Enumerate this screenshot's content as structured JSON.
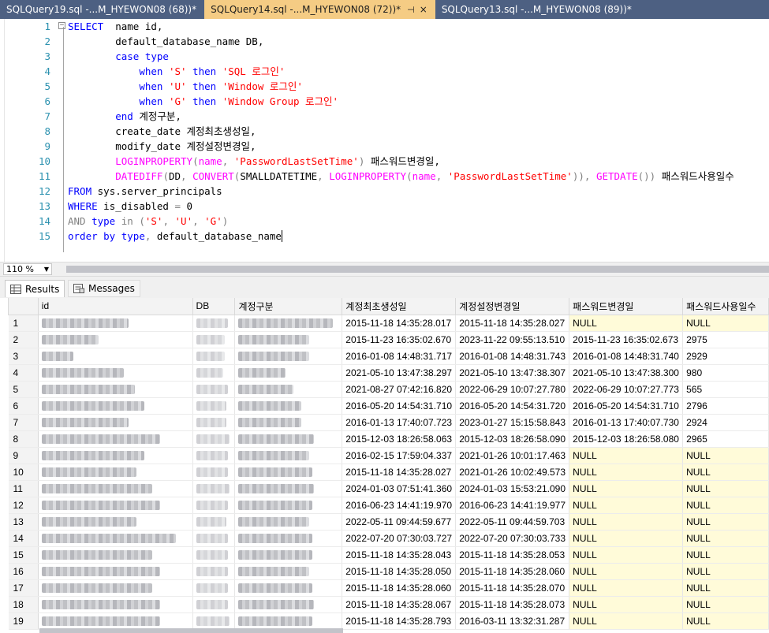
{
  "tabs": [
    {
      "label": "SQLQuery19.sql -...M_HYEWON08 (68))*",
      "active": false
    },
    {
      "label": "SQLQuery14.sql -...M_HYEWON08 (72))*",
      "active": true
    },
    {
      "label": "SQLQuery13.sql -...M_HYEWON08 (89))*",
      "active": false
    }
  ],
  "tab_pin_glyph": "⊣",
  "tab_close_glyph": "×",
  "editor": {
    "lines": [
      {
        "n": "1",
        "fold": "⊟",
        "tokens": [
          [
            "kw",
            "SELECT"
          ],
          [
            "plain",
            "  name id,"
          ]
        ]
      },
      {
        "n": "2",
        "tokens": [
          [
            "plain",
            "        default_database_name DB,"
          ]
        ]
      },
      {
        "n": "3",
        "tokens": [
          [
            "plain",
            "        "
          ],
          [
            "kw",
            "case type"
          ]
        ]
      },
      {
        "n": "4",
        "tokens": [
          [
            "plain",
            "            "
          ],
          [
            "kw",
            "when "
          ],
          [
            "str",
            "'S'"
          ],
          [
            "kw",
            " then "
          ],
          [
            "str",
            "'SQL 로그인'"
          ]
        ]
      },
      {
        "n": "5",
        "tokens": [
          [
            "plain",
            "            "
          ],
          [
            "kw",
            "when "
          ],
          [
            "str",
            "'U'"
          ],
          [
            "kw",
            " then "
          ],
          [
            "str",
            "'Window 로그인'"
          ]
        ]
      },
      {
        "n": "6",
        "tokens": [
          [
            "plain",
            "            "
          ],
          [
            "kw",
            "when "
          ],
          [
            "str",
            "'G'"
          ],
          [
            "kw",
            " then "
          ],
          [
            "str",
            "'Window Group 로그인'"
          ]
        ]
      },
      {
        "n": "7",
        "tokens": [
          [
            "plain",
            "        "
          ],
          [
            "kw",
            "end"
          ],
          [
            "plain",
            " 계정구분,"
          ]
        ]
      },
      {
        "n": "8",
        "tokens": [
          [
            "plain",
            "        create_date 계정최초생성일,"
          ]
        ]
      },
      {
        "n": "9",
        "tokens": [
          [
            "plain",
            "        modify_date 계정설정변경일,"
          ]
        ]
      },
      {
        "n": "10",
        "tokens": [
          [
            "plain",
            "        "
          ],
          [
            "fn",
            "LOGINPROPERTY"
          ],
          [
            "gray",
            "("
          ],
          [
            "fn",
            "name"
          ],
          [
            "gray",
            ", "
          ],
          [
            "str",
            "'PasswordLastSetTime'"
          ],
          [
            "gray",
            ")"
          ],
          [
            "plain",
            " 패스워드변경일,"
          ]
        ]
      },
      {
        "n": "11",
        "tokens": [
          [
            "plain",
            "        "
          ],
          [
            "fn",
            "DATEDIFF"
          ],
          [
            "gray",
            "("
          ],
          [
            "plain",
            "DD"
          ],
          [
            "gray",
            ", "
          ],
          [
            "fn",
            "CONVERT"
          ],
          [
            "gray",
            "("
          ],
          [
            "plain",
            "SMALLDATETIME"
          ],
          [
            "gray",
            ", "
          ],
          [
            "fn",
            "LOGINPROPERTY"
          ],
          [
            "gray",
            "("
          ],
          [
            "fn",
            "name"
          ],
          [
            "gray",
            ", "
          ],
          [
            "str",
            "'PasswordLastSetTime'"
          ],
          [
            "gray",
            "))"
          ],
          [
            "gray",
            ", "
          ],
          [
            "fn",
            "GETDATE"
          ],
          [
            "gray",
            "())"
          ],
          [
            "plain",
            " 패스워드사용일수"
          ]
        ]
      },
      {
        "n": "12",
        "tokens": [
          [
            "kw",
            "FROM"
          ],
          [
            "plain",
            " "
          ],
          [
            "plain",
            "sys.server_principals"
          ]
        ]
      },
      {
        "n": "13",
        "tokens": [
          [
            "kw",
            "WHERE"
          ],
          [
            "plain",
            " is_disabled "
          ],
          [
            "gray",
            "="
          ],
          [
            "plain",
            " 0"
          ]
        ]
      },
      {
        "n": "14",
        "tokens": [
          [
            "gray",
            "AND"
          ],
          [
            "plain",
            " "
          ],
          [
            "kw",
            "type"
          ],
          [
            "plain",
            " "
          ],
          [
            "gray",
            "in"
          ],
          [
            "plain",
            " "
          ],
          [
            "gray",
            "("
          ],
          [
            "str",
            "'S'"
          ],
          [
            "gray",
            ", "
          ],
          [
            "str",
            "'U'"
          ],
          [
            "gray",
            ", "
          ],
          [
            "str",
            "'G'"
          ],
          [
            "gray",
            ")"
          ]
        ]
      },
      {
        "n": "15",
        "tokens": [
          [
            "kw",
            "order by"
          ],
          [
            "plain",
            " "
          ],
          [
            "kw",
            "type"
          ],
          [
            "gray",
            ","
          ],
          [
            "plain",
            " default_database_name"
          ]
        ],
        "cursor": true
      }
    ]
  },
  "zoom": {
    "value": "110 %"
  },
  "results_tabs": [
    {
      "label": "Results",
      "icon": "grid-icon"
    },
    {
      "label": "Messages",
      "icon": "messages-icon"
    }
  ],
  "grid": {
    "columns": [
      "id",
      "DB",
      "계정구분",
      "계정최초생성일",
      "계정설정변경일",
      "패스워드변경일",
      "패스워드사용일수"
    ],
    "rows": [
      {
        "n": "1",
        "created": "2015-11-18 14:35:28.017",
        "modified": "2015-11-18 14:35:28.027",
        "pwd_changed": "NULL",
        "pwd_days": "NULL"
      },
      {
        "n": "2",
        "created": "2015-11-23 16:35:02.670",
        "modified": "2023-11-22 09:55:13.510",
        "pwd_changed": "2015-11-23 16:35:02.673",
        "pwd_days": "2975"
      },
      {
        "n": "3",
        "created": "2016-01-08 14:48:31.717",
        "modified": "2016-01-08 14:48:31.743",
        "pwd_changed": "2016-01-08 14:48:31.740",
        "pwd_days": "2929"
      },
      {
        "n": "4",
        "created": "2021-05-10 13:47:38.297",
        "modified": "2021-05-10 13:47:38.307",
        "pwd_changed": "2021-05-10 13:47:38.300",
        "pwd_days": "980"
      },
      {
        "n": "5",
        "created": "2021-08-27 07:42:16.820",
        "modified": "2022-06-29 10:07:27.780",
        "pwd_changed": "2022-06-29 10:07:27.773",
        "pwd_days": "565"
      },
      {
        "n": "6",
        "created": "2016-05-20 14:54:31.710",
        "modified": "2016-05-20 14:54:31.720",
        "pwd_changed": "2016-05-20 14:54:31.710",
        "pwd_days": "2796"
      },
      {
        "n": "7",
        "created": "2016-01-13 17:40:07.723",
        "modified": "2023-01-27 15:15:58.843",
        "pwd_changed": "2016-01-13 17:40:07.730",
        "pwd_days": "2924"
      },
      {
        "n": "8",
        "created": "2015-12-03 18:26:58.063",
        "modified": "2015-12-03 18:26:58.090",
        "pwd_changed": "2015-12-03 18:26:58.080",
        "pwd_days": "2965"
      },
      {
        "n": "9",
        "created": "2016-02-15 17:59:04.337",
        "modified": "2021-01-26 10:01:17.463",
        "pwd_changed": "NULL",
        "pwd_days": "NULL"
      },
      {
        "n": "10",
        "created": "2015-11-18 14:35:28.027",
        "modified": "2021-01-26 10:02:49.573",
        "pwd_changed": "NULL",
        "pwd_days": "NULL"
      },
      {
        "n": "11",
        "created": "2024-01-03 07:51:41.360",
        "modified": "2024-01-03 15:53:21.090",
        "pwd_changed": "NULL",
        "pwd_days": "NULL"
      },
      {
        "n": "12",
        "created": "2016-06-23 14:41:19.970",
        "modified": "2016-06-23 14:41:19.977",
        "pwd_changed": "NULL",
        "pwd_days": "NULL"
      },
      {
        "n": "13",
        "created": "2022-05-11 09:44:59.677",
        "modified": "2022-05-11 09:44:59.703",
        "pwd_changed": "NULL",
        "pwd_days": "NULL"
      },
      {
        "n": "14",
        "created": "2022-07-20 07:30:03.727",
        "modified": "2022-07-20 07:30:03.733",
        "pwd_changed": "NULL",
        "pwd_days": "NULL"
      },
      {
        "n": "15",
        "created": "2015-11-18 14:35:28.043",
        "modified": "2015-11-18 14:35:28.053",
        "pwd_changed": "NULL",
        "pwd_days": "NULL"
      },
      {
        "n": "16",
        "created": "2015-11-18 14:35:28.050",
        "modified": "2015-11-18 14:35:28.060",
        "pwd_changed": "NULL",
        "pwd_days": "NULL"
      },
      {
        "n": "17",
        "created": "2015-11-18 14:35:28.060",
        "modified": "2015-11-18 14:35:28.070",
        "pwd_changed": "NULL",
        "pwd_days": "NULL"
      },
      {
        "n": "18",
        "created": "2015-11-18 14:35:28.067",
        "modified": "2015-11-18 14:35:28.073",
        "pwd_changed": "NULL",
        "pwd_days": "NULL"
      },
      {
        "n": "19",
        "created": "2015-11-18 14:35:28.793",
        "modified": "2016-03-11 13:32:31.287",
        "pwd_changed": "NULL",
        "pwd_days": "NULL"
      }
    ],
    "null_highlight_color": "#fffbd9"
  },
  "colors": {
    "tabstrip_bg": "#4d6082",
    "active_tab_bg": "#f5cc84",
    "keyword": "#0000ff",
    "function": "#ff00ff",
    "string": "#ff0000",
    "line_number": "#2b91af"
  }
}
